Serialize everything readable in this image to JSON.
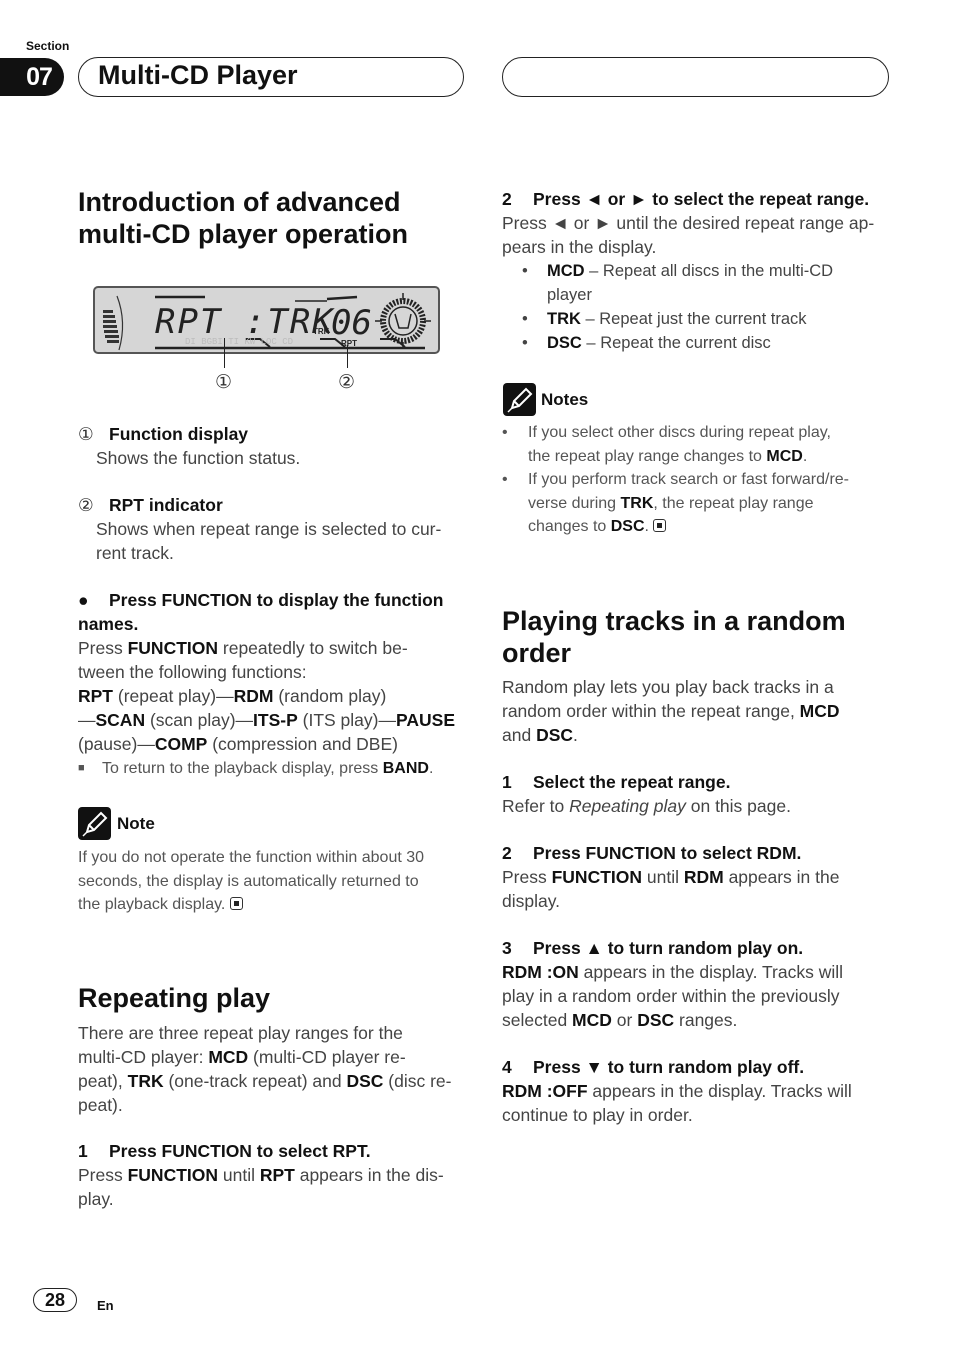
{
  "header": {
    "section_label": "Section",
    "section_number": "07",
    "chapter_title": "Multi-CD Player",
    "right_box_text": ""
  },
  "intro": {
    "heading_line1": "Introduction of advanced",
    "heading_line2": "multi-CD player operation",
    "display": {
      "main_text": "RPT :TRK",
      "trk_label": "TRK",
      "track_number": "06",
      "rpt_label": "RPT",
      "callout_1": "①",
      "callout_2": "②"
    },
    "items": [
      {
        "marker": "①",
        "title": "Function display",
        "desc_line1": "Shows the function status.",
        "desc_line2": ""
      },
      {
        "marker": "②",
        "title": "RPT indicator",
        "desc_line1": "Shows when repeat range is selected to cur-",
        "desc_line2": "rent track."
      }
    ],
    "press_function": {
      "bullet": "●",
      "heading_line1": "Press FUNCTION to display the function",
      "heading_line2": "names.",
      "l1_a": "Press ",
      "l1_b": "FUNCTION",
      "l1_c": " repeatedly to switch be-",
      "l2": "tween the following functions:",
      "l3_a": "RPT",
      "l3_b": " (repeat play)—",
      "l3_c": "RDM",
      "l3_d": " (random play)",
      "l4_a": "—",
      "l4_b": "SCAN",
      "l4_c": " (scan play)—",
      "l4_d": "ITS-P",
      "l4_e": " (ITS play)—",
      "l4_f": "PAUSE",
      "l5_a": "(pause)—",
      "l5_b": "COMP",
      "l5_c": " (compression and DBE)",
      "tip_bullet": "■",
      "tip_a": "To return to the playback display, press ",
      "tip_b": "BAND",
      "tip_c": "."
    },
    "note": {
      "title": "Note",
      "line1": "If you do not operate the function within about 30",
      "line2": "seconds, the display is automatically returned to",
      "line3": "the playback display."
    }
  },
  "repeating": {
    "heading": "Repeating play",
    "l1": "There are three repeat play ranges for the",
    "l2_a": "multi-CD player: ",
    "l2_b": "MCD",
    "l2_c": " (multi-CD player re-",
    "l3_a": "peat), ",
    "l3_b": "TRK",
    "l3_c": " (one-track repeat) and ",
    "l3_d": "DSC",
    "l3_e": " (disc re-",
    "l4": "peat).",
    "step1": {
      "num": "1",
      "title": "Press FUNCTION to select RPT.",
      "l1_a": "Press ",
      "l1_b": "FUNCTION",
      "l1_c": " until ",
      "l1_d": "RPT",
      "l1_e": " appears in the dis-",
      "l2": "play."
    },
    "step2": {
      "num": "2",
      "title": "Press ◄ or ► to select the repeat range.",
      "l1": "Press ◄ or ► until the desired repeat range ap-",
      "l2": "pears in the display.",
      "options": [
        {
          "key": "MCD",
          "desc_line1": " – Repeat all discs in the multi-CD",
          "desc_line2": "player"
        },
        {
          "key": "TRK",
          "desc_line1": " – Repeat just the current track",
          "desc_line2": ""
        },
        {
          "key": "DSC",
          "desc_line1": " – Repeat the current disc",
          "desc_line2": ""
        }
      ]
    },
    "notes": {
      "title": "Notes",
      "n1_l1": "If you select other discs during repeat play,",
      "n1_l2_a": "the repeat play range changes to ",
      "n1_l2_b": "MCD",
      "n1_l2_c": ".",
      "n2_l1": "If you perform track search or fast forward/re-",
      "n2_l2_a": "verse during ",
      "n2_l2_b": "TRK",
      "n2_l2_c": ", the repeat play range",
      "n2_l3_a": "changes to ",
      "n2_l3_b": "DSC",
      "n2_l3_c": "."
    }
  },
  "random": {
    "heading_line1": "Playing tracks in a random",
    "heading_line2": "order",
    "l1": "Random play lets you play back tracks in a",
    "l2_a": "random order within the repeat range, ",
    "l2_b": "MCD",
    "l3_a": "and ",
    "l3_b": "DSC",
    "l3_c": ".",
    "step1": {
      "num": "1",
      "title": "Select the repeat range.",
      "l1_a": "Refer to ",
      "l1_b": "Repeating play",
      "l1_c": " on this page."
    },
    "step2": {
      "num": "2",
      "title": "Press FUNCTION to select RDM.",
      "l1_a": "Press ",
      "l1_b": "FUNCTION",
      "l1_c": " until ",
      "l1_d": "RDM",
      "l1_e": " appears in the",
      "l2": "display."
    },
    "step3": {
      "num": "3",
      "title": "Press ▲ to turn random play on.",
      "l1_a": "RDM :ON",
      "l1_b": " appears in the display. Tracks will",
      "l2": "play in a random order within the previously",
      "l3_a": "selected ",
      "l3_b": "MCD",
      "l3_c": " or ",
      "l3_d": "DSC",
      "l3_e": " ranges."
    },
    "step4": {
      "num": "4",
      "title": "Press ▼ to turn random play off.",
      "l1_a": "RDM :OFF",
      "l1_b": " appears in the display. Tracks will",
      "l2": "continue to play in order."
    }
  },
  "footer": {
    "page_number": "28",
    "language": "En"
  }
}
